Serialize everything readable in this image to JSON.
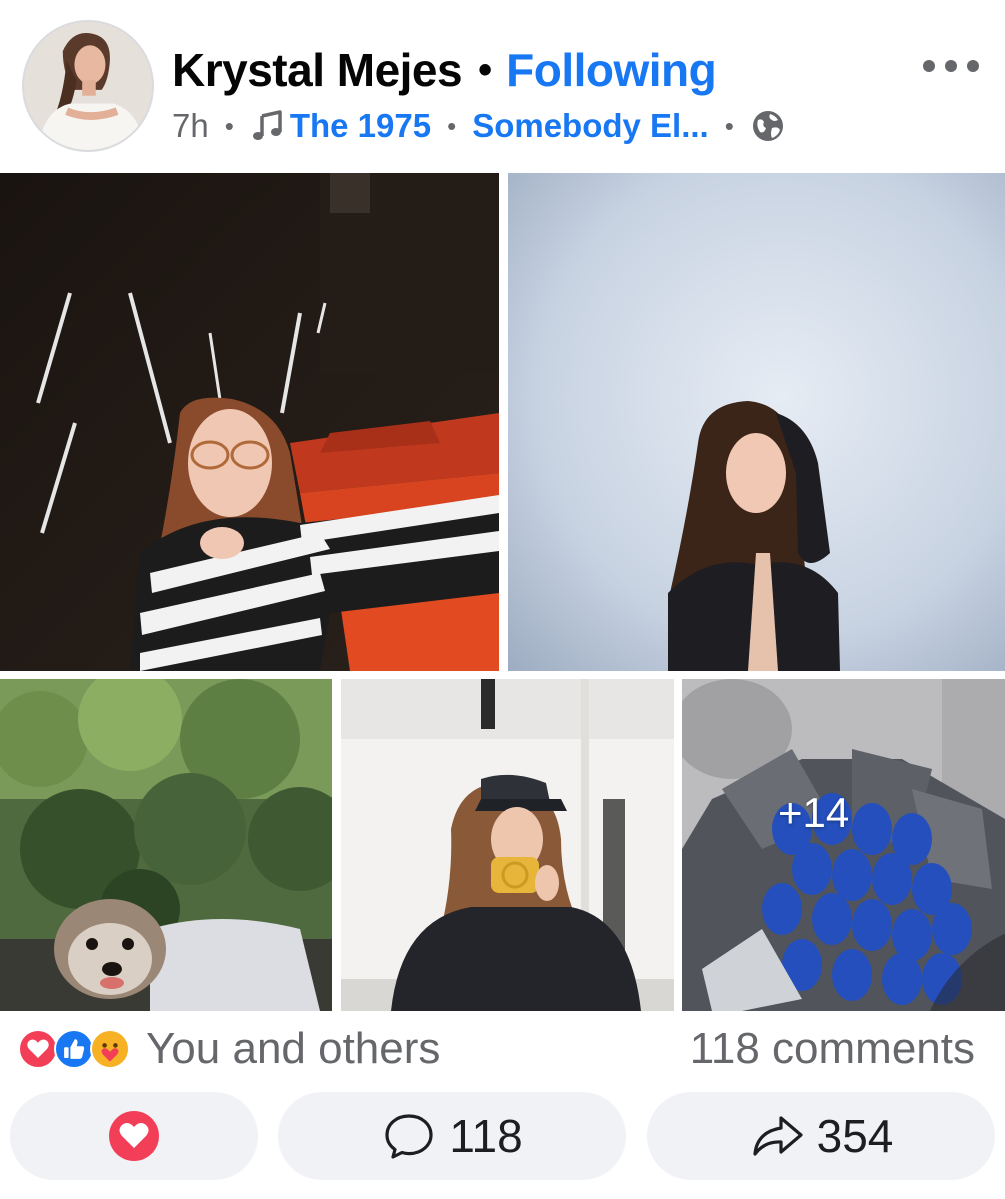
{
  "post": {
    "author": "Krystal Mejes",
    "follow_status": "Following",
    "time": "7h",
    "music": {
      "artist": "The 1975",
      "song": "Somebody El..."
    },
    "more_icon": "more-horizontal-icon",
    "privacy_icon": "globe-icon"
  },
  "photos": {
    "extra_count": "+14"
  },
  "reactions": {
    "types": [
      "love",
      "like",
      "care"
    ],
    "summary": "You and others",
    "comments_label": "118 comments"
  },
  "actions": {
    "comment_count": "118",
    "share_count": "354"
  },
  "colors": {
    "accent": "#1877f2",
    "love": "#f33e58",
    "secondary_text": "#65676b",
    "button_bg": "#f0f2f5"
  }
}
